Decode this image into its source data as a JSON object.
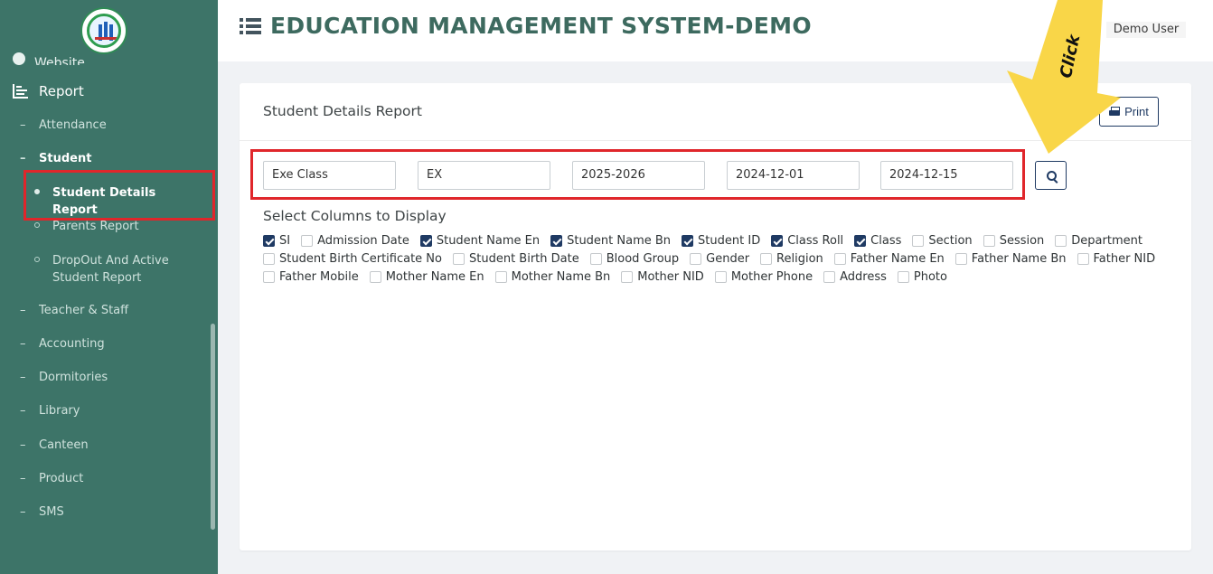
{
  "app": {
    "title": "EDUCATION MANAGEMENT SYSTEM-DEMO",
    "user": "Demo User"
  },
  "sidebar": {
    "website": "Website",
    "report": "Report",
    "items": [
      {
        "label": "Attendance"
      },
      {
        "label": "Student"
      },
      {
        "label": "Teacher & Staff"
      },
      {
        "label": "Accounting"
      },
      {
        "label": "Dormitories"
      },
      {
        "label": "Library"
      },
      {
        "label": "Canteen"
      },
      {
        "label": "Product"
      },
      {
        "label": "SMS"
      }
    ],
    "student_sub": [
      {
        "label": "Student Details Report"
      },
      {
        "label": "Parents Report"
      },
      {
        "label": "DropOut And Active Student Report"
      }
    ]
  },
  "card": {
    "title": "Student Details Report",
    "print_label": "Print",
    "filters": [
      "Exe Class",
      "EX",
      "2025-2026",
      "2024-12-01",
      "2024-12-15"
    ],
    "columns_heading": "Select Columns to Display",
    "columns": [
      {
        "label": "SI",
        "checked": true
      },
      {
        "label": "Admission Date",
        "checked": false
      },
      {
        "label": "Student Name En",
        "checked": true
      },
      {
        "label": "Student Name Bn",
        "checked": true
      },
      {
        "label": "Student ID",
        "checked": true
      },
      {
        "label": "Class Roll",
        "checked": true
      },
      {
        "label": "Class",
        "checked": true
      },
      {
        "label": "Section",
        "checked": false
      },
      {
        "label": "Session",
        "checked": false
      },
      {
        "label": "Department",
        "checked": false
      },
      {
        "label": "Student Birth Certificate No",
        "checked": false
      },
      {
        "label": "Student Birth Date",
        "checked": false
      },
      {
        "label": "Blood Group",
        "checked": false
      },
      {
        "label": "Gender",
        "checked": false
      },
      {
        "label": "Religion",
        "checked": false
      },
      {
        "label": "Father Name En",
        "checked": false
      },
      {
        "label": "Father Name Bn",
        "checked": false
      },
      {
        "label": "Father NID",
        "checked": false
      },
      {
        "label": "Father Mobile",
        "checked": false
      },
      {
        "label": "Mother Name En",
        "checked": false
      },
      {
        "label": "Mother Name Bn",
        "checked": false
      },
      {
        "label": "Mother NID",
        "checked": false
      },
      {
        "label": "Mother Phone",
        "checked": false
      },
      {
        "label": "Address",
        "checked": false
      },
      {
        "label": "Photo",
        "checked": false
      }
    ]
  },
  "annotation": {
    "label": "Click",
    "arrow_color": "#f9d648"
  }
}
